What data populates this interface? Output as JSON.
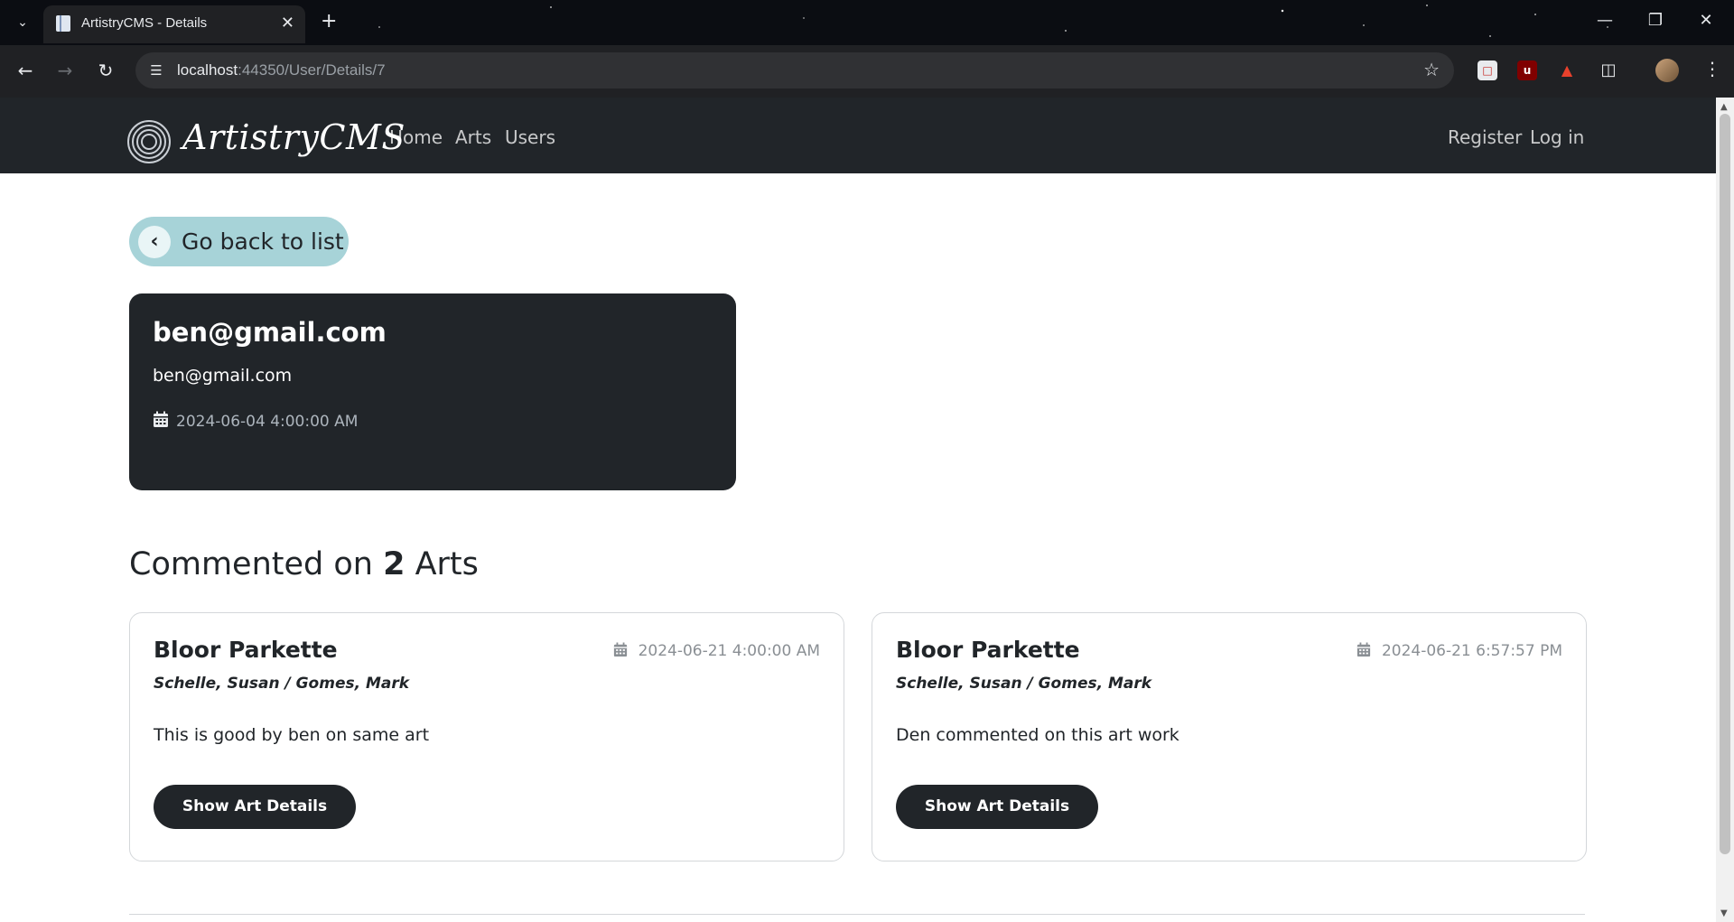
{
  "browser": {
    "tab_title": "ArtistryCMS - Details",
    "url_host": "localhost",
    "url_path": ":44350/User/Details/7"
  },
  "navbar": {
    "brand": "ArtistryCMS",
    "links": [
      "Home",
      "Arts",
      "Users"
    ],
    "auth_links": [
      "Register",
      "Log in"
    ]
  },
  "back_button": {
    "label": "Go back to list"
  },
  "user": {
    "title": "ben@gmail.com",
    "email": "ben@gmail.com",
    "date": "2024-06-04 4:00:00 AM"
  },
  "comments_section": {
    "prefix": "Commented on",
    "count": "2",
    "suffix": "Arts"
  },
  "arts": [
    {
      "title": "Bloor Parkette",
      "date": "2024-06-21 4:00:00 AM",
      "authors": "Schelle, Susan / Gomes, Mark",
      "comment": "This is good by ben on same art",
      "button": "Show Art Details"
    },
    {
      "title": "Bloor Parkette",
      "date": "2024-06-21 6:57:57 PM",
      "authors": "Schelle, Susan / Gomes, Mark",
      "comment": "Den commented on this art work",
      "button": "Show Art Details"
    }
  ]
}
